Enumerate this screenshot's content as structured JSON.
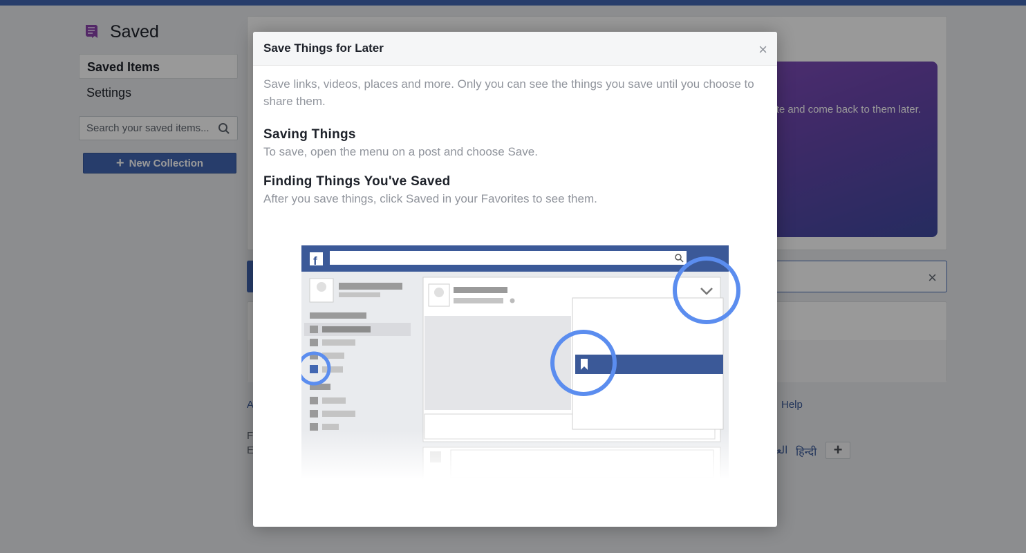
{
  "left": {
    "title": "Saved",
    "nav": [
      {
        "label": "Saved Items",
        "active": true
      },
      {
        "label": "Settings",
        "active": false
      }
    ],
    "search_placeholder": "Search your saved items...",
    "new_collection": "New Collection"
  },
  "background": {
    "promo_text": "te and come back to them later.",
    "footer_link_fragment": "A",
    "footer_help": "Help",
    "footer_frag_1": "F",
    "footer_frag_2": "E",
    "lang_arabic": "العر",
    "lang_hindi": "हिन्दी",
    "more_langs": "+"
  },
  "dialog": {
    "title": "Save Things for Later",
    "close": "×",
    "intro": "Save links, videos, places and more. Only you can see the things you save until you choose to share them.",
    "sections": [
      {
        "heading": "Saving Things",
        "text": "To save, open the menu on a post and choose Save."
      },
      {
        "heading": "Finding Things You've Saved",
        "text": "After you save things, click Saved in your Favorites to see them."
      }
    ]
  },
  "colors": {
    "brand": "#4267b2",
    "highlight_ring": "#5b8def",
    "background": "#e9ebee"
  }
}
